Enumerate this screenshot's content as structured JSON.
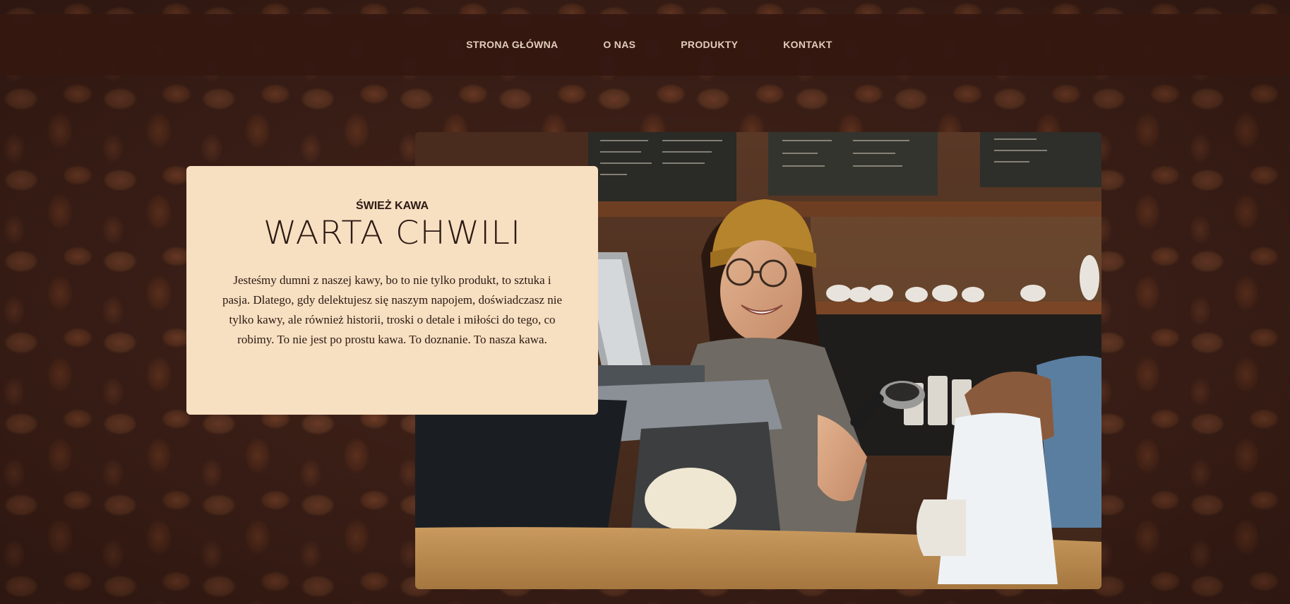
{
  "nav": {
    "items": [
      {
        "label": "STRONA GŁÓWNA"
      },
      {
        "label": "O NAS"
      },
      {
        "label": "PRODUKTY"
      },
      {
        "label": "KONTAKT"
      }
    ]
  },
  "intro": {
    "kicker": "ŚWIEŻ KAWA",
    "headline": "WARTA CHWILI",
    "text": "Jesteśmy dumni z naszej kawy, bo to nie tylko produkt, to sztuka i pasja. Dlatego, gdy delektujesz się naszym napojem, doświadczasz nie tylko kawy, ale również historii, troski o detale i miłości do tego, co robimy. To nie jest po prostu kawa. To doznanie. To nasza kawa."
  },
  "colors": {
    "nav_background": "#341811",
    "nav_text": "#e2cdbd",
    "card_background": "#f7dfc1",
    "text_dark": "#2b1a14",
    "page_background": "#3b1f17"
  },
  "icons": {
    "background": "coffee-beans-background",
    "photo": "barista-photo"
  }
}
